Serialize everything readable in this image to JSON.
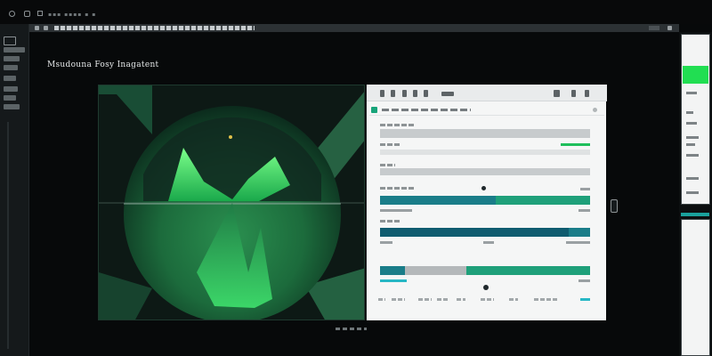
{
  "window": {
    "heading": "Msudouna Fosy Inagatent"
  },
  "colors": {
    "accent_green": "#21de52",
    "panel_teal": "#1a7d89",
    "deep_teal": "#0f5c70",
    "success_green": "#18a47a",
    "surface_dark": "#07090a",
    "panel_light": "#f5f6f6"
  },
  "icons": {
    "back": "back-arrow-icon",
    "forward": "forward-arrow-icon",
    "home": "home-icon",
    "settings": "gear-icon",
    "menu": "hamburger-icon"
  },
  "form": {
    "progress_bars": [
      {
        "name": "bar-1",
        "fill_fraction": 0.55
      },
      {
        "name": "bar-2",
        "fill_fraction": 0.9
      },
      {
        "name": "bar-3",
        "fill_fraction": 0.41
      }
    ]
  }
}
